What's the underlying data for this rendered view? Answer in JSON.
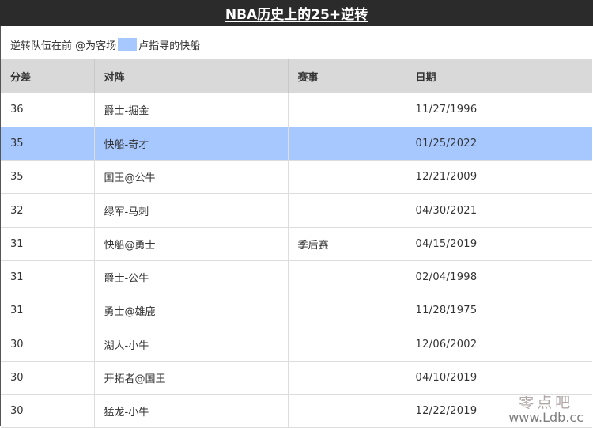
{
  "title": "NBA历史上的25+逆转",
  "legend": {
    "text_before": "逆转队伍在前 @为客场",
    "text_after": "卢指导的快船",
    "highlight_color": "#a7c7ff"
  },
  "table": {
    "headers": [
      "分差",
      "对阵",
      "赛事",
      "日期"
    ],
    "rows": [
      {
        "margin": "36",
        "matchup": "爵士-掘金",
        "event": "",
        "date": "11/27/1996",
        "highlight": false
      },
      {
        "margin": "35",
        "matchup": "快船-奇才",
        "event": "",
        "date": "01/25/2022",
        "highlight": true
      },
      {
        "margin": "35",
        "matchup": "国王@公牛",
        "event": "",
        "date": "12/21/2009",
        "highlight": false
      },
      {
        "margin": "32",
        "matchup": "绿军-马刺",
        "event": "",
        "date": "04/30/2021",
        "highlight": false
      },
      {
        "margin": "31",
        "matchup": "快船@勇士",
        "event": "季后赛",
        "date": "04/15/2019",
        "highlight": false
      },
      {
        "margin": "31",
        "matchup": "爵士-公牛",
        "event": "",
        "date": "02/04/1998",
        "highlight": false
      },
      {
        "margin": "31",
        "matchup": "勇士@雄鹿",
        "event": "",
        "date": "11/28/1975",
        "highlight": false
      },
      {
        "margin": "30",
        "matchup": "湖人-小牛",
        "event": "",
        "date": "12/06/2002",
        "highlight": false
      },
      {
        "margin": "30",
        "matchup": "开拓者@国王",
        "event": "",
        "date": "04/10/2019",
        "highlight": false
      },
      {
        "margin": "30",
        "matchup": "猛龙-小牛",
        "event": "",
        "date": "12/22/2019",
        "highlight": false
      }
    ]
  },
  "watermark": {
    "line1": "零点吧",
    "line2": "www.Ldb.cc"
  }
}
